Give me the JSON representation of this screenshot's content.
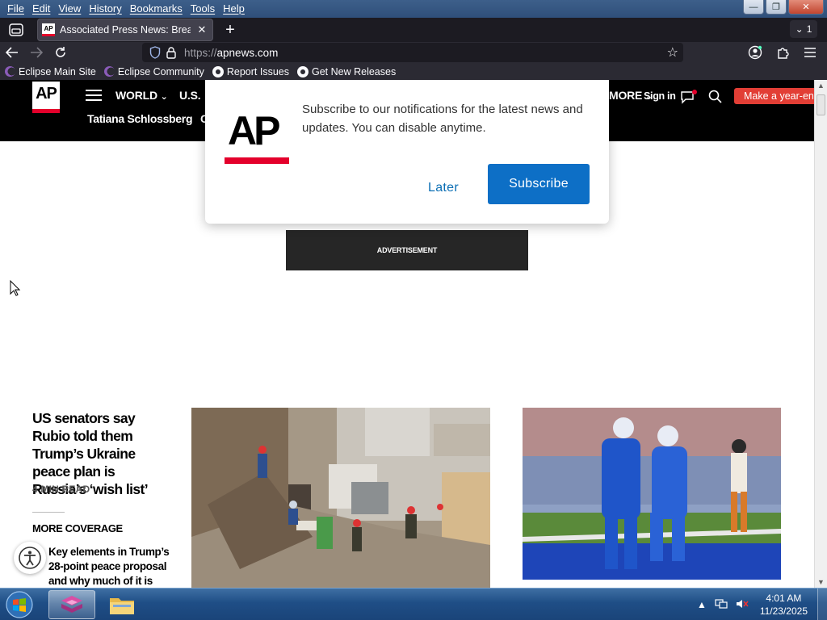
{
  "menubar": {
    "items": [
      "File",
      "Edit",
      "View",
      "History",
      "Bookmarks",
      "Tools",
      "Help"
    ]
  },
  "window_controls": {
    "minimize": "—",
    "maximize": "❐",
    "close": "✕"
  },
  "tab": {
    "title": "Associated Press News: Breaking",
    "favicon_text": "AP",
    "count": "1"
  },
  "urlbar": {
    "protocol": "https://",
    "domain": "apnews.com"
  },
  "bookmarks": [
    {
      "label": "Eclipse Main Site",
      "icon": "eclipse-icon"
    },
    {
      "label": "Eclipse Community",
      "icon": "eclipse-icon"
    },
    {
      "label": "Report Issues",
      "icon": "github-icon"
    },
    {
      "label": "Get New Releases",
      "icon": "github-icon"
    }
  ],
  "site": {
    "logo": "AP",
    "nav": {
      "world": "WORLD",
      "us": "U.S.",
      "more": "MORE",
      "trending_1": "Tatiana Schlossberg",
      "trending_2": "C"
    },
    "sign_in": "Sign in",
    "donate": "Make a year-end",
    "advertisement": "ADVERTISEMENT"
  },
  "prompt": {
    "logo": "AP",
    "message": "Subscribe to our notifications for the latest news and updates. You can disable anytime.",
    "later": "Later",
    "subscribe": "Subscribe"
  },
  "article": {
    "headline": "US senators say Rubio told them Trump’s Ukraine peace plan is Russia’s ‘wish list’",
    "read_time": "4 MIN READ",
    "more_coverage": "MORE COVERAGE",
    "sub_headline": "Key elements in Trump’s 28-point peace proposal and why much of it is"
  },
  "taskbar": {
    "time": "4:01 AM",
    "date": "11/23/2025"
  },
  "colors": {
    "ap_red": "#e4002b",
    "subscribe_blue": "#0d6fc6",
    "donate_red": "#e23e35",
    "firefox_dark": "#2b2a33"
  }
}
